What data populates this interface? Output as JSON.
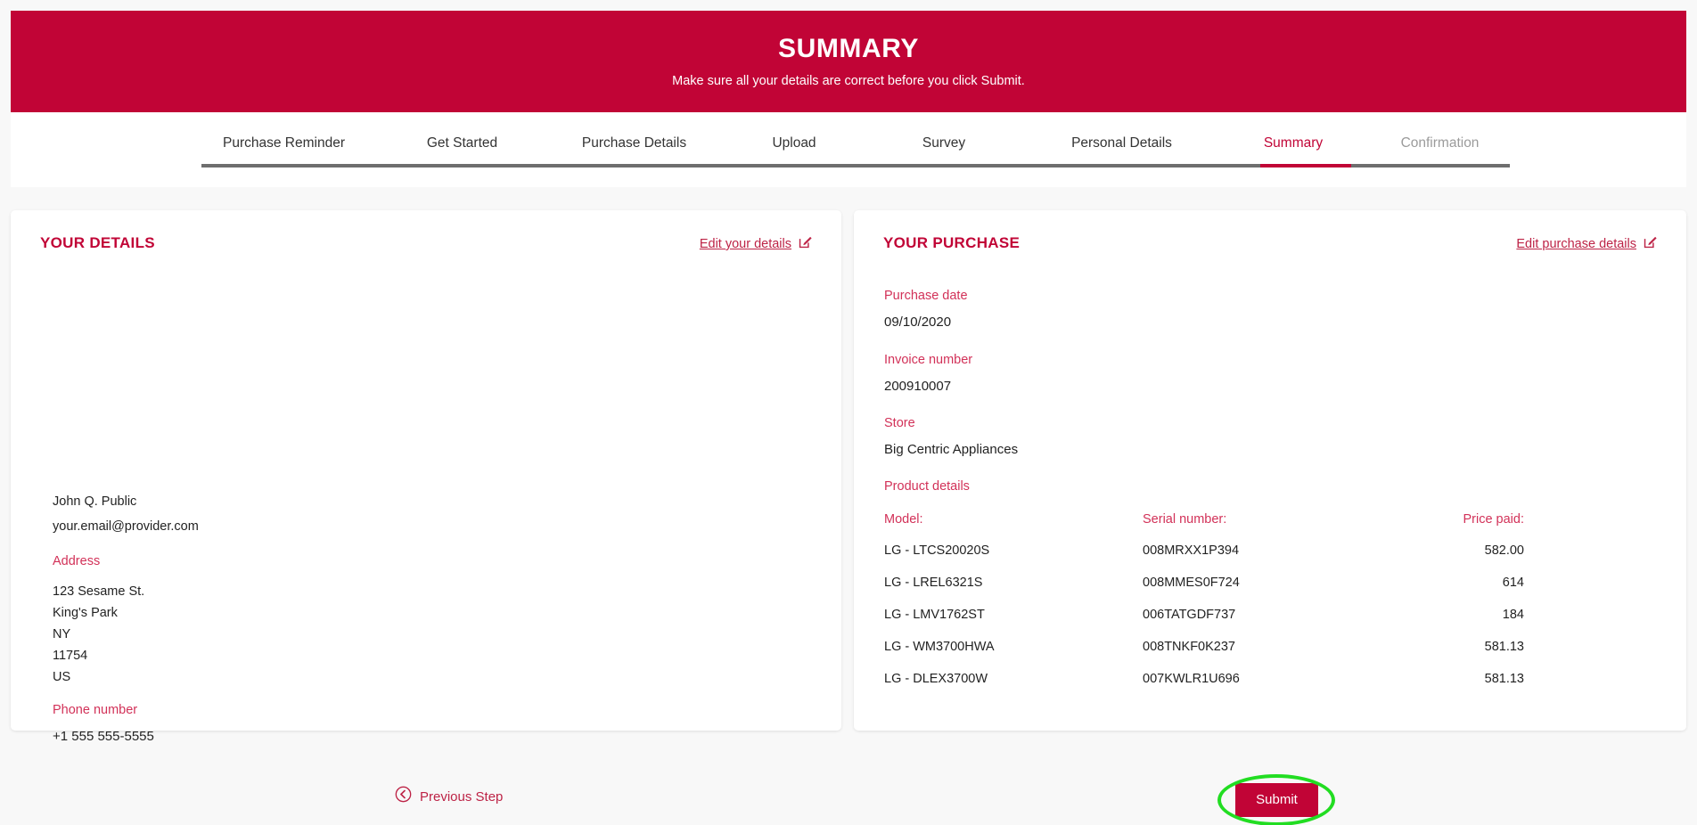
{
  "theme": {
    "brand_red": "#c10436",
    "link_red": "#bd2346",
    "label_red": "#d23158",
    "disabled_gray": "#9b9b9b",
    "track_gray": "#6e6e6e",
    "highlight_green": "#22dd22",
    "page_bg": "#f8f8f8"
  },
  "hero": {
    "title": "SUMMARY",
    "subtitle": "Make sure all your details are correct before you click Submit."
  },
  "steps": [
    {
      "label": "Purchase Reminder",
      "state": "done"
    },
    {
      "label": "Get Started",
      "state": "done"
    },
    {
      "label": "Purchase Details",
      "state": "done"
    },
    {
      "label": "Upload",
      "state": "done"
    },
    {
      "label": "Survey",
      "state": "done"
    },
    {
      "label": "Personal Details",
      "state": "done"
    },
    {
      "label": "Summary",
      "state": "active"
    },
    {
      "label": "Confirmation",
      "state": "disabled"
    }
  ],
  "your_details": {
    "heading": "YOUR DETAILS",
    "edit_link": "Edit your details",
    "edit_icon": "pencil-square-icon",
    "name": "John Q. Public",
    "email": "your.email@provider.com",
    "address_label": "Address",
    "address_lines": [
      "123 Sesame St.",
      "King's Park",
      "NY",
      "11754",
      "US"
    ],
    "phone_label": "Phone number",
    "phone": "+1 555 555-5555"
  },
  "your_purchase": {
    "heading": "YOUR PURCHASE",
    "edit_link": "Edit purchase details",
    "edit_icon": "pencil-square-icon",
    "purchase_date_label": "Purchase date",
    "purchase_date": "09/10/2020",
    "invoice_number_label": "Invoice number",
    "invoice_number": "200910007",
    "store_label": "Store",
    "store": "Big Centric Appliances",
    "product_details_label": "Product details",
    "table": {
      "columns": [
        "Model:",
        "Serial number:",
        "Price paid:"
      ],
      "rows": [
        {
          "model": "LG - LTCS20020S",
          "serial": "008MRXX1P394",
          "price": "582.00"
        },
        {
          "model": "LG - LREL6321S",
          "serial": "008MMES0F724",
          "price": "614"
        },
        {
          "model": "LG - LMV1762ST",
          "serial": "006TATGDF737",
          "price": "184"
        },
        {
          "model": "LG - WM3700HWA",
          "serial": "008TNKF0K237",
          "price": "581.13"
        },
        {
          "model": "LG - DLEX3700W",
          "serial": "007KWLR1U696",
          "price": "581.13"
        }
      ]
    }
  },
  "footer": {
    "previous_step": "Previous Step",
    "previous_icon": "circle-chevron-left-icon",
    "submit": "Submit"
  }
}
